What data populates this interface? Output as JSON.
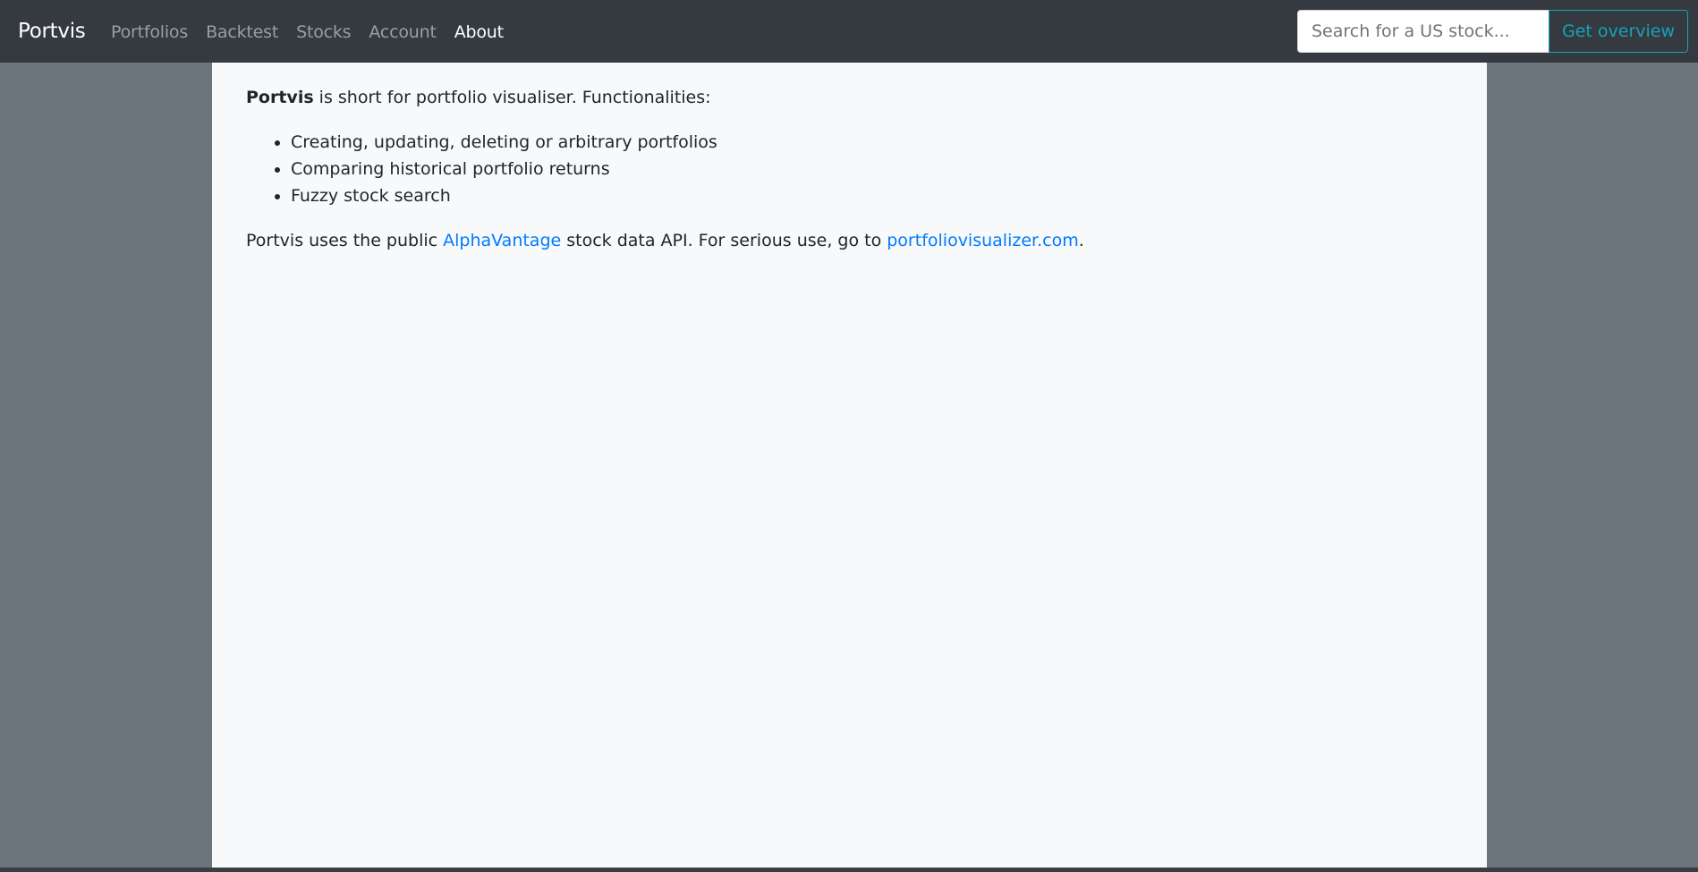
{
  "navbar": {
    "brand": "Portvis",
    "links": [
      {
        "label": "Portfolios",
        "active": false
      },
      {
        "label": "Backtest",
        "active": false
      },
      {
        "label": "Stocks",
        "active": false
      },
      {
        "label": "Account",
        "active": false
      },
      {
        "label": "About",
        "active": true
      }
    ],
    "search": {
      "placeholder": "Search for a US stock...",
      "value": "",
      "button_label": "Get overview"
    }
  },
  "about": {
    "intro_bold": "Portvis",
    "intro_rest": " is short for portfolio visualiser. Functionalities:",
    "features": [
      "Creating, updating, deleting or arbitrary portfolios",
      "Comparing historical portfolio returns",
      "Fuzzy stock search"
    ],
    "outro": {
      "text_before": "Portvis uses the public ",
      "link1": "AlphaVantage",
      "text_middle": " stock data API. For serious use, go to ",
      "link2": "portfoliovisualizer.com",
      "text_after": "."
    }
  },
  "colors": {
    "navbar_bg": "#343a40",
    "page_bg": "#6c757d",
    "content_bg": "#f8f9fa",
    "link": "#007bff",
    "info": "#17a2b8"
  }
}
